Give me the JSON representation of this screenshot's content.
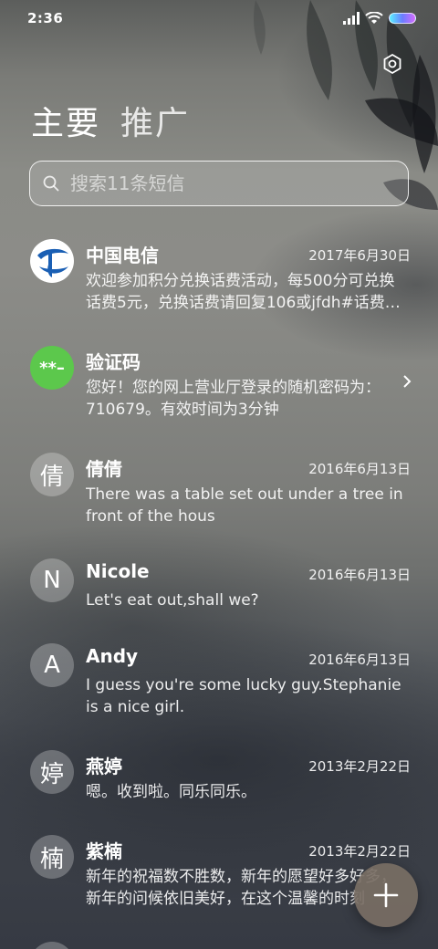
{
  "status_bar": {
    "time": "2:36"
  },
  "header": {
    "tabs": [
      {
        "label": "主要"
      },
      {
        "label": "推广"
      }
    ]
  },
  "search": {
    "placeholder": "搜索11条短信"
  },
  "conversations": [
    {
      "avatar": "telecom-logo",
      "name": "中国电信",
      "date": "2017年6月30日",
      "preview": "欢迎参加积分兑换话费活动，每500分可兑换话费5元，兑换话费请回复106或jfdh#话费…"
    },
    {
      "avatar_text": "**–",
      "name": "验证码",
      "date": "",
      "preview": "您好！您的网上营业厅登录的随机密码为：710679。有效时间为3分钟"
    },
    {
      "avatar_text": "倩",
      "name": "倩倩",
      "date": "2016年6月13日",
      "preview": "There was a table set out under a tree in front of the hous"
    },
    {
      "avatar_text": "N",
      "name": "Nicole",
      "date": "2016年6月13日",
      "preview": "Let's eat out,shall we?"
    },
    {
      "avatar_text": "A",
      "name": "Andy",
      "date": "2016年6月13日",
      "preview": "I guess you're some lucky guy.Stephanie is a nice girl."
    },
    {
      "avatar_text": "婷",
      "name": "燕婷",
      "date": "2013年2月22日",
      "preview": "嗯。收到啦。同乐同乐。"
    },
    {
      "avatar_text": "楠",
      "name": "紫楠",
      "date": "2013年2月22日",
      "preview": "新年的祝福数不胜数，新年的愿望好多好多，新年的问候依旧美好，在这个温馨的时刻"
    }
  ],
  "colors": {
    "green_avatar": "#5cc84c",
    "fab": "#786e64",
    "telecom_blue": "#1a5fb4"
  },
  "icons": {
    "settings": "gear-icon",
    "search": "search-icon",
    "chevron": "chevron-right-icon",
    "fab": "plus-icon"
  }
}
